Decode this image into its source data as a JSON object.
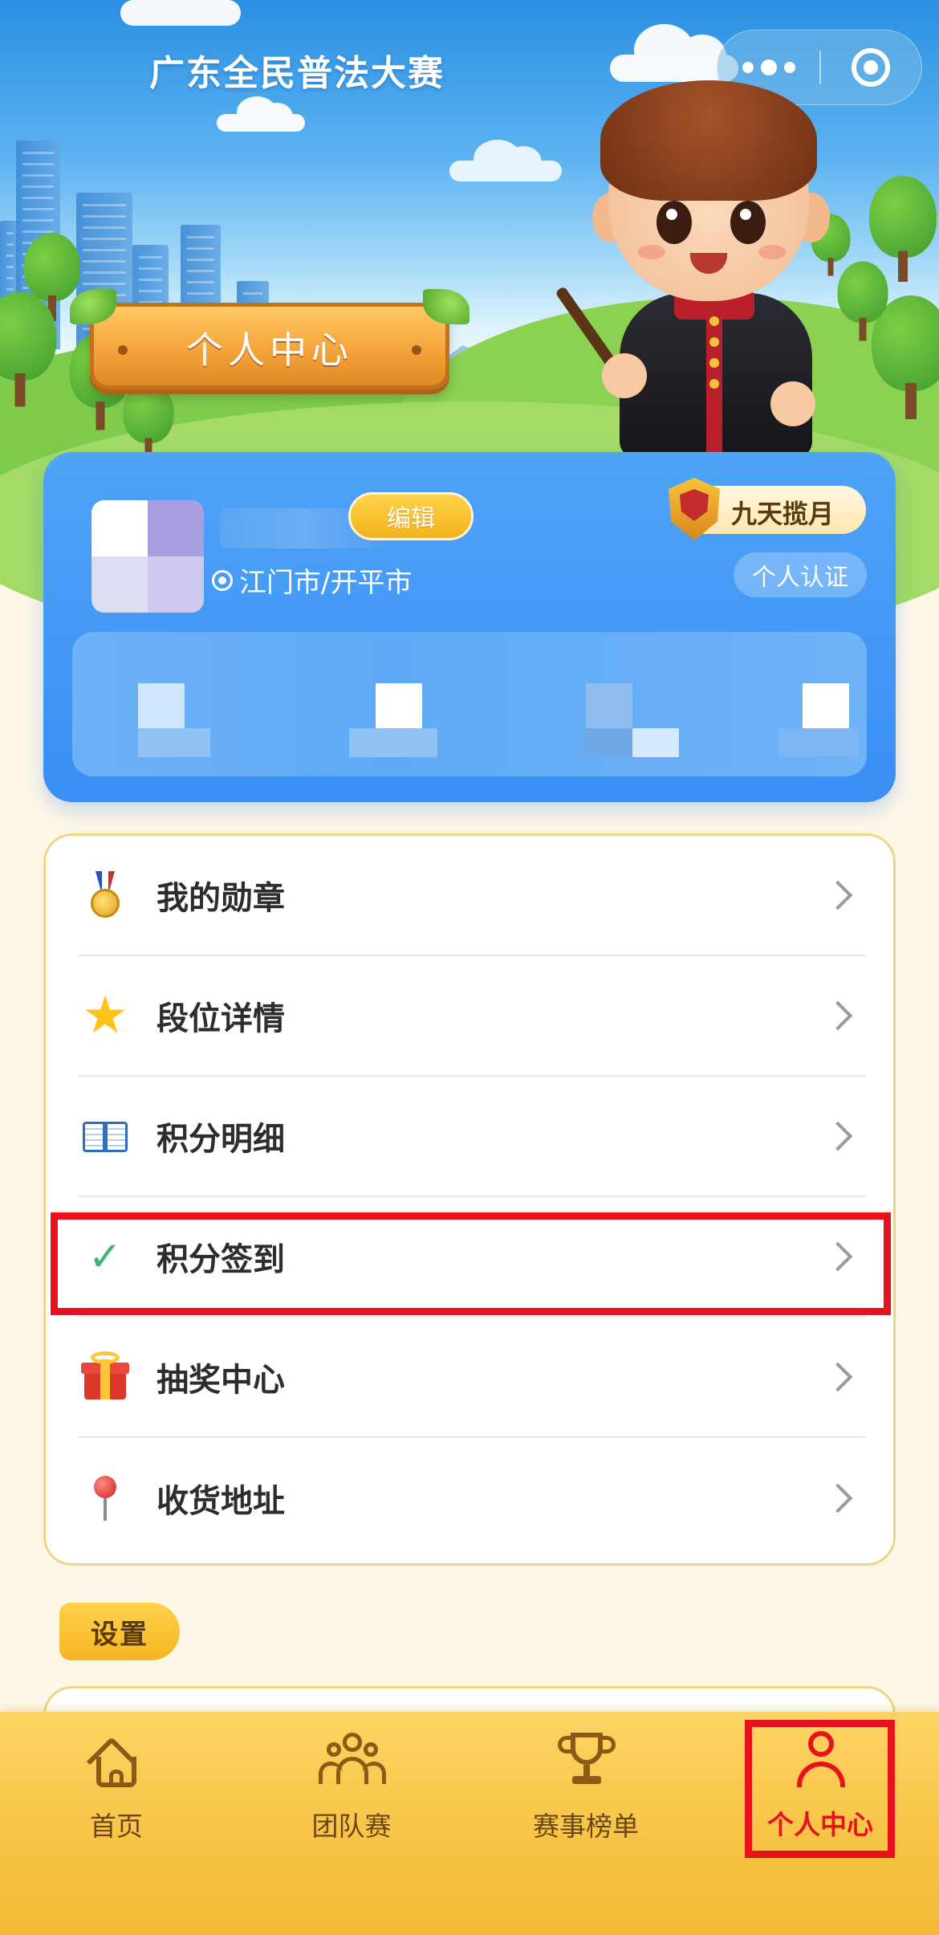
{
  "header": {
    "app_title": "广东全民普法大赛",
    "banner_title": "个人中心"
  },
  "profile": {
    "edit_label": "编辑",
    "location": "江门市/开平市",
    "rank_label": "九天揽月",
    "verify_label": "个人认证"
  },
  "menu": {
    "items": [
      {
        "label": "我的勋章",
        "icon": "medal-icon"
      },
      {
        "label": "段位详情",
        "icon": "star-icon"
      },
      {
        "label": "积分明细",
        "icon": "book-icon"
      },
      {
        "label": "积分签到",
        "icon": "check-icon",
        "highlighted": true
      },
      {
        "label": "抽奖中心",
        "icon": "gift-icon"
      },
      {
        "label": "收货地址",
        "icon": "pin-icon"
      }
    ]
  },
  "settings": {
    "label": "设置"
  },
  "tabbar": {
    "tabs": [
      {
        "label": "首页",
        "icon": "home-icon"
      },
      {
        "label": "团队赛",
        "icon": "team-icon"
      },
      {
        "label": "赛事榜单",
        "icon": "trophy-icon"
      },
      {
        "label": "个人中心",
        "icon": "user-icon",
        "active": true
      }
    ]
  },
  "colors": {
    "accent_red": "#e8121c",
    "card_blue": "#3a8ef5",
    "tab_gold": "#f7c344"
  }
}
